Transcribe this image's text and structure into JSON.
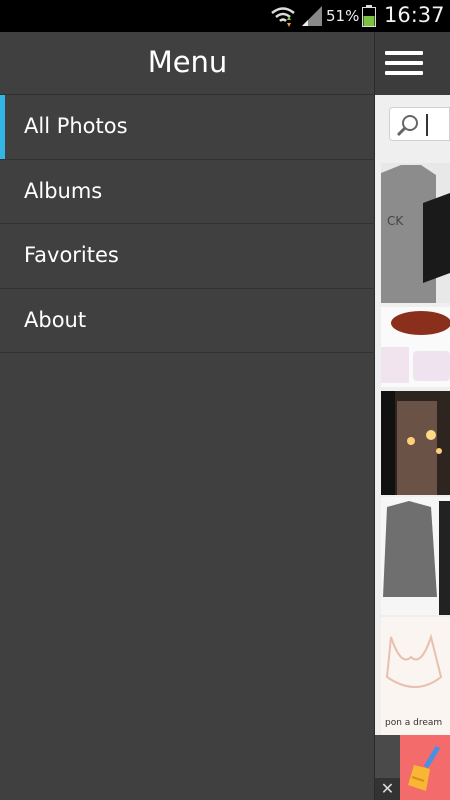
{
  "status_bar": {
    "battery_percent": "51%",
    "time": "16:37",
    "icons": [
      "wifi-icon",
      "signal-icon",
      "battery-icon"
    ]
  },
  "drawer": {
    "title": "Menu",
    "items": [
      {
        "label": "All Photos",
        "active": true
      },
      {
        "label": "Albums",
        "active": false
      },
      {
        "label": "Favorites",
        "active": false
      },
      {
        "label": "About",
        "active": false
      }
    ],
    "accent_color": "#33b5e5"
  },
  "content": {
    "icons": [
      "menu-icon",
      "search-icon",
      "close-icon",
      "broom-icon"
    ]
  }
}
